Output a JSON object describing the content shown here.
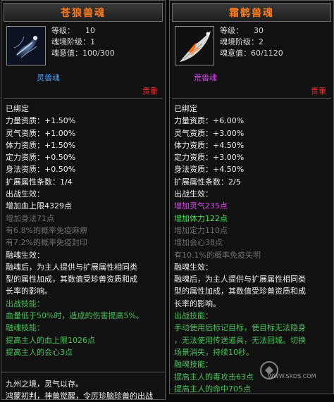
{
  "left": {
    "title": "苍狼兽魂",
    "level_label": "等级：",
    "level_value": "10",
    "stage_label": "魂境阶级：",
    "stage_value": "1",
    "will_label": "魂意值：",
    "will_value": "100/300",
    "type": "灵兽魂",
    "precious": "贵重",
    "lines": [
      {
        "text": "已绑定",
        "c": "w"
      },
      {
        "text": "力量资质：+1.50%",
        "c": "w"
      },
      {
        "text": "灵气资质：+1.00%",
        "c": "w"
      },
      {
        "text": "体力资质：+1.50%",
        "c": "w"
      },
      {
        "text": "定力资质：+0.50%",
        "c": "w"
      },
      {
        "text": "身法资质：+0.50%",
        "c": "w"
      },
      {
        "text": "扩展属性条数：1/4",
        "c": "w"
      },
      {
        "text": "出战生效：",
        "c": "w"
      },
      {
        "text": "增加血上限4329点",
        "c": "w"
      },
      {
        "text": "增加身法71点",
        "c": "g"
      },
      {
        "text": "有6.8%的概率免疫麻痹",
        "c": "g"
      },
      {
        "text": "有7.2%的概率免疫封印",
        "c": "g"
      },
      {
        "text": "融魂生效：",
        "c": "w"
      },
      {
        "text": "融魂后，为主人提供与扩展属性相同类",
        "c": "w"
      },
      {
        "text": "型的属性加成，其数值受珍兽资质和成",
        "c": "w"
      },
      {
        "text": "长率的影响。",
        "c": "w"
      },
      {
        "text": "出战技能：",
        "c": "gr"
      },
      {
        "text": "血量低于50%时，造成的伤害提高5%。",
        "c": "gr"
      },
      {
        "text": "融魂技能：",
        "c": "gr"
      },
      {
        "text": "提高主人的血上限1026点",
        "c": "gr"
      },
      {
        "text": "提高主人的会心3点",
        "c": "gr"
      }
    ],
    "bottom_lines": [
      "九州之境，灵气以存。",
      "鸿蒙初判，神兽觉醒，令厉珍脑珍兽的出战"
    ]
  },
  "right": {
    "title": "霜鹤兽魂",
    "level_label": "等级：",
    "level_value": "30",
    "stage_label": "魂境阶级：",
    "stage_value": "2",
    "will_label": "魂意值：",
    "will_value": "60/1120",
    "type": "荒兽魂",
    "precious": "贵重",
    "lines": [
      {
        "text": "已绑定",
        "c": "w"
      },
      {
        "text": "力量资质：+6.00%",
        "c": "w"
      },
      {
        "text": "灵气资质：+3.00%",
        "c": "w"
      },
      {
        "text": "体力资质：+4.50%",
        "c": "w"
      },
      {
        "text": "定力资质：+3.00%",
        "c": "w"
      },
      {
        "text": "身法资质：+4.50%",
        "c": "w"
      },
      {
        "text": "扩展属性条数：2/5",
        "c": "w"
      },
      {
        "text": "出战生效：",
        "c": "w"
      },
      {
        "text": "增加灵气235点",
        "c": "pu"
      },
      {
        "text": "增加体力122点",
        "c": "grb"
      },
      {
        "text": "增加定力110点",
        "c": "g"
      },
      {
        "text": "增加会心38点",
        "c": "g"
      },
      {
        "text": "有10.1%的概率免疫失明",
        "c": "g"
      },
      {
        "text": "融魂生效：",
        "c": "w"
      },
      {
        "text": "融魂后，为主人提供与扩展属性相同类",
        "c": "w"
      },
      {
        "text": "型的属性加成，其数值受珍兽资质和成",
        "c": "w"
      },
      {
        "text": "长率的影响。",
        "c": "w"
      },
      {
        "text": "出战技能：",
        "c": "gr"
      },
      {
        "text": "手动使用后标记目标，使目标无法隐身",
        "c": "gr"
      },
      {
        "text": "，无法使用传送道具，无法回城。切换",
        "c": "gr"
      },
      {
        "text": "场景消失，持续10秒。",
        "c": "gr"
      },
      {
        "text": "融魂技能：",
        "c": "gr"
      },
      {
        "text": "提高主人的毒攻击63点",
        "c": "gr"
      },
      {
        "text": "提高主人的命中705点",
        "c": "gr"
      }
    ]
  },
  "watermark": {
    "logo_text": "神仙代售",
    "url": "WWW.SXDS.COM"
  },
  "colors": {
    "title": "#ff7a1a",
    "precious": "#ff2a2a",
    "green": "#49c45a",
    "purple": "#dd44ee",
    "gray": "#6e6e6e"
  }
}
